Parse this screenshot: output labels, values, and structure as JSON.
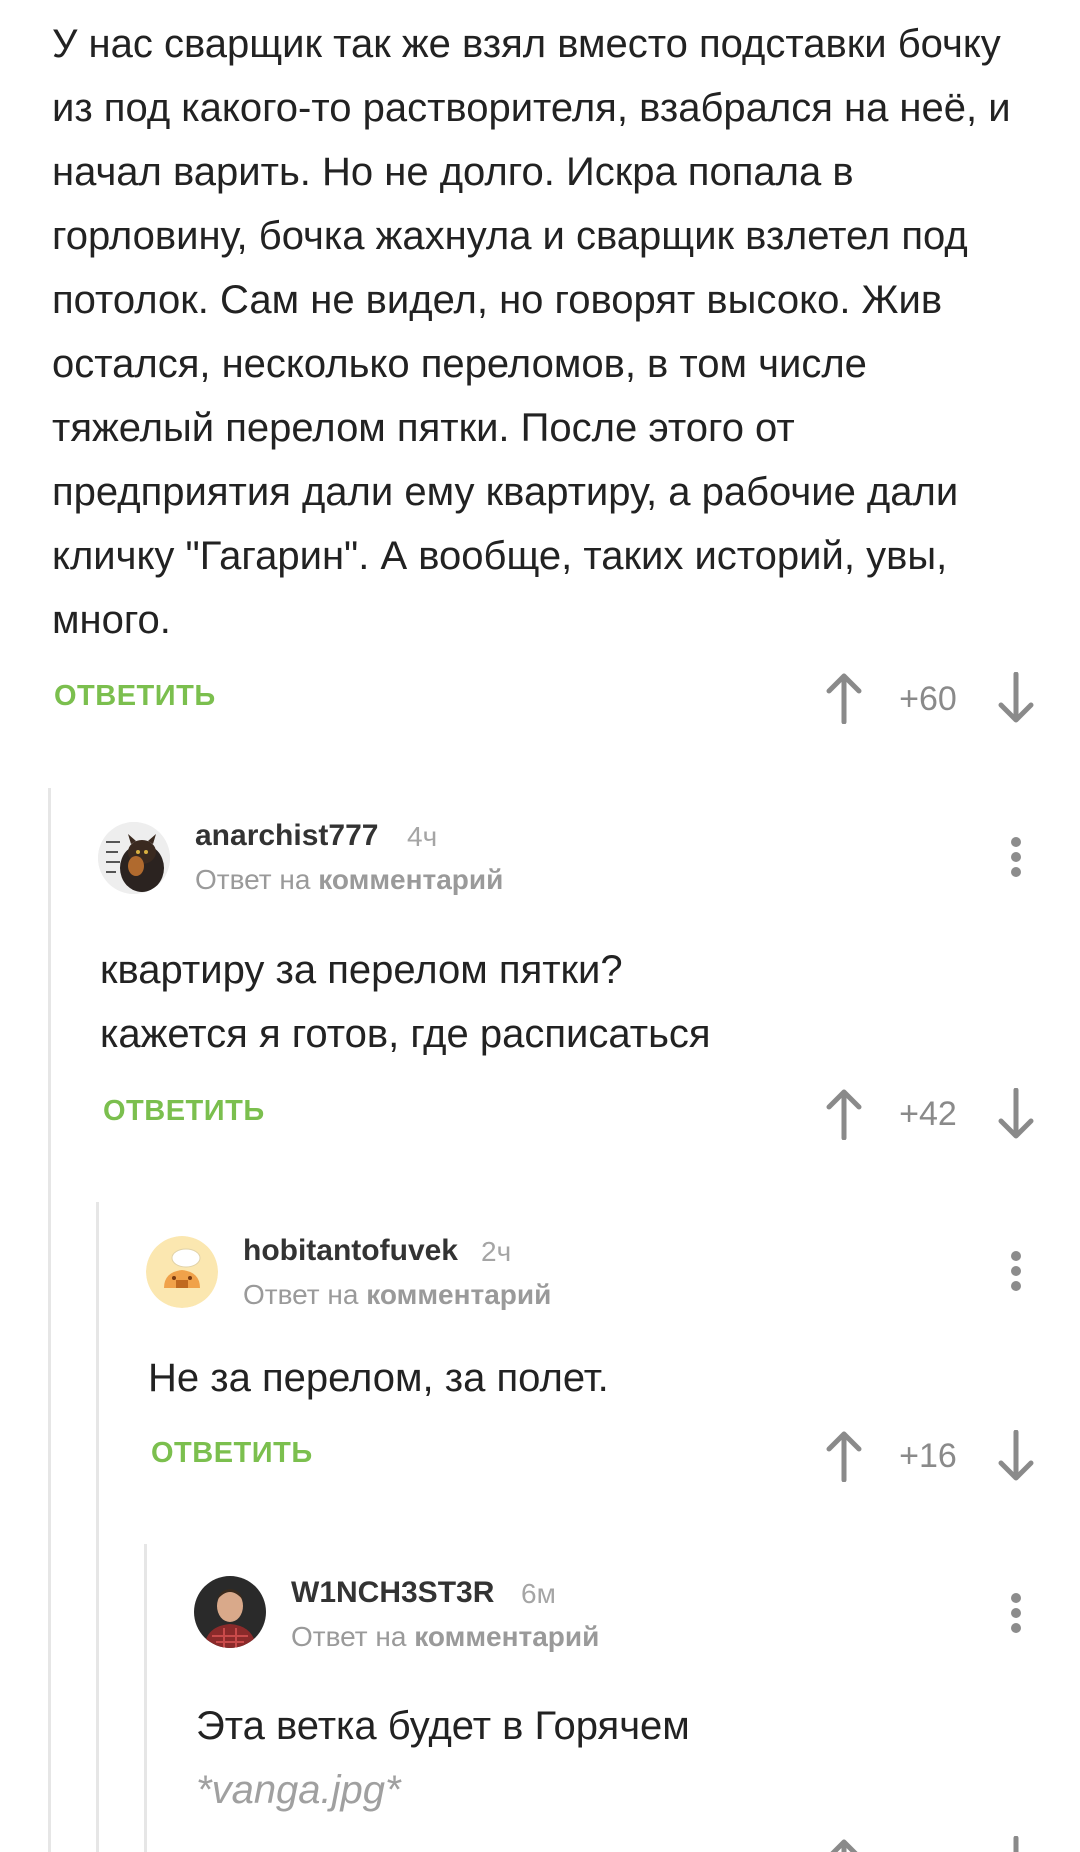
{
  "comment_top": {
    "text": "У нас сварщик так же взял вместо подставки бочку из под какого-то растворителя, взабрался на неё, и начал варить. Но не долго. Искра попала в горловину, бочка жахнула и сварщик взлетел под потолок. Сам не видел, но говорят высоко. Жив остался, несколько переломов, в том числе тяжелый перелом пятки. После этого от предприятия дали ему квартиру, а рабочие дали кличку \"Гагарин\". А вообще, таких историй, увы, много.",
    "reply_label": "ОТВЕТИТЬ",
    "rating": "+60"
  },
  "comment_1": {
    "username": "anarchist777",
    "time": "4ч",
    "reply_to_prefix": "Ответ на",
    "reply_to_link": "комментарий",
    "line1": "квартиру за перелом пятки?",
    "line2": "кажется я готов, где расписаться",
    "reply_label": "ОТВЕТИТЬ",
    "rating": "+42"
  },
  "comment_2": {
    "username": "hobitantofuvek",
    "time": "2ч",
    "reply_to_prefix": "Ответ на",
    "reply_to_link": "комментарий",
    "line1": "Не за перелом, за полет.",
    "reply_label": "ОТВЕТИТЬ",
    "rating": "+16"
  },
  "comment_3": {
    "username": "W1NCH3ST3R",
    "time": "6м",
    "reply_to_prefix": "Ответ на",
    "reply_to_link": "комментарий",
    "line1": "Эта ветка будет в Горячем",
    "line2": "*vanga.jpg*"
  },
  "colors": {
    "accent_green": "#7bbf4e",
    "muted": "#8a8a8a",
    "thread_line": "#e6e6e6"
  },
  "icons": [
    "upvote-arrow-icon",
    "downvote-arrow-icon",
    "more-vertical-icon",
    "avatar"
  ]
}
